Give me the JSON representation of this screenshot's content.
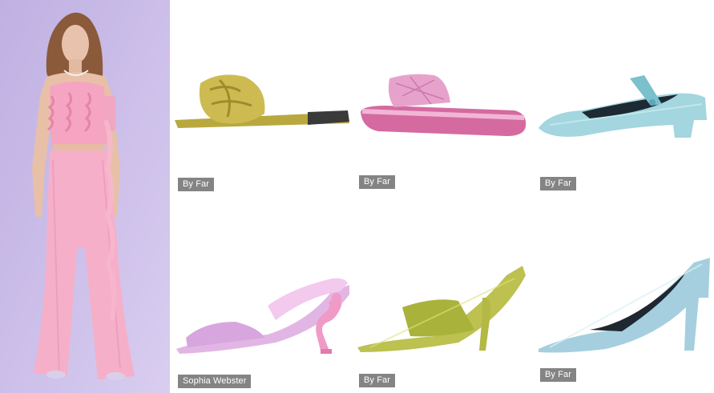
{
  "model_photo": {
    "alt": "Model wearing pink ruffled outfit"
  },
  "products": [
    {
      "brand": "By Far",
      "item": "gold-slide-sandal"
    },
    {
      "brand": "By Far",
      "item": "pink-platform-slide"
    },
    {
      "brand": "By Far",
      "item": "blue-mary-jane-heel"
    },
    {
      "brand": "Sophia Webster",
      "item": "pink-flamingo-heel-mule"
    },
    {
      "brand": "By Far",
      "item": "green-heeled-mule"
    },
    {
      "brand": "By Far",
      "item": "blue-pointed-pump"
    }
  ],
  "colors": {
    "background_lavender": "#c6b7e6",
    "outfit_pink": "#f3a9c4",
    "gold": "#c8b44a",
    "pink": "#e79ac4",
    "blue": "#9fd3dd",
    "lilac": "#e2b6e4",
    "green": "#b7bd4d",
    "tag_gray": "#707070"
  }
}
